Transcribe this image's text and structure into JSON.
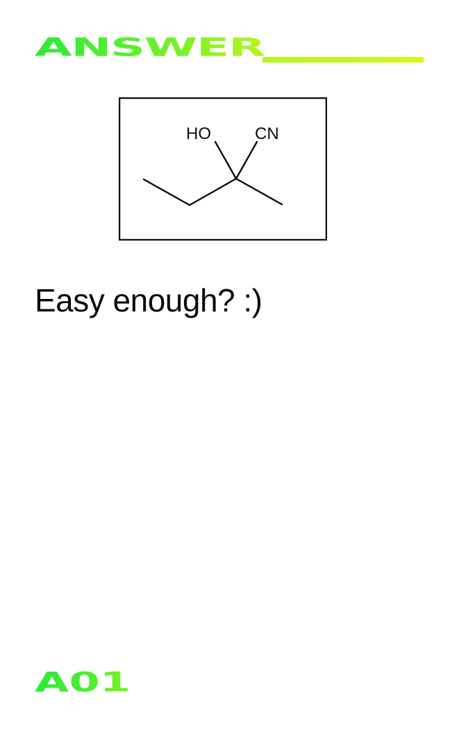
{
  "header": {
    "title": "ANSWER"
  },
  "structure": {
    "labels": {
      "hydroxyl": "HO",
      "nitrile": "CN"
    }
  },
  "headline": "Easy enough? :)",
  "footer": {
    "code": "A01"
  },
  "colors": {
    "accent_green": "#2ee83a",
    "accent_lime": "#c6f71c",
    "text": "#0b0b0b",
    "shadow": "#d3d8d8"
  }
}
